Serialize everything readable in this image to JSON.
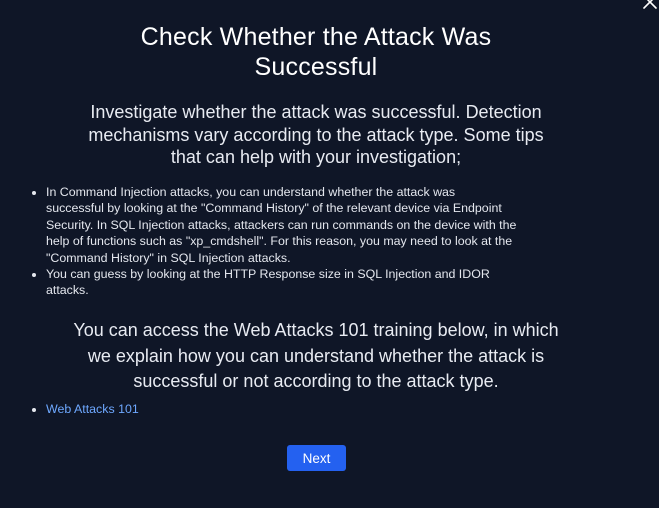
{
  "dialog": {
    "title_lines": [
      "Check Whether the Attack Was",
      "Successful"
    ],
    "intro_lines": [
      "Investigate whether the attack was successful. Detection",
      "mechanisms vary according to the attack type. Some tips",
      "that can help with your investigation;"
    ],
    "tips": [
      {
        "lines": [
          "In Command Injection attacks, you can understand whether the attack was",
          "successful by looking at the \"Command History\" of the relevant device via Endpoint",
          "Security. In SQL Injection attacks, attackers can run commands on the device with the",
          "help of functions such as \"xp_cmdshell\". For this reason, you may need to look at the",
          "\"Command History\" in SQL Injection attacks."
        ]
      },
      {
        "lines": [
          "You can guess by looking at the HTTP Response size in SQL Injection and IDOR",
          "attacks."
        ]
      }
    ],
    "outro_lines": [
      "You can access the Web Attacks 101 training below, in which",
      "we explain how you can understand whether the attack is",
      "successful or not according to the attack type."
    ],
    "link_label": "Web Attacks 101",
    "next_label": "Next",
    "close_icon": "close-icon"
  },
  "colors": {
    "background": "#0f1627",
    "accent": "#2461f0",
    "link": "#6ea8ff"
  }
}
